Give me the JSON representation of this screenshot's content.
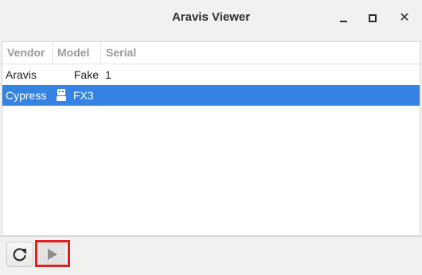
{
  "window": {
    "title": "Aravis Viewer",
    "controls": [
      "minimize-icon",
      "maximize-icon",
      "close-icon"
    ]
  },
  "table": {
    "columns": [
      "Vendor",
      "Model",
      "Serial"
    ],
    "rows": [
      {
        "vendor": "Aravis",
        "model": "Fake",
        "serial": "1",
        "selected": false
      },
      {
        "vendor": "Cypress",
        "model": "FX3",
        "serial": "",
        "selected": true,
        "icon": "usb-device-icon"
      }
    ]
  },
  "toolbar": {
    "buttons": [
      {
        "icon": "refresh-icon"
      },
      {
        "icon": "play-icon",
        "highlighted": true
      }
    ]
  },
  "colors": {
    "selection": "#3584e4",
    "highlight": "#e02020"
  }
}
